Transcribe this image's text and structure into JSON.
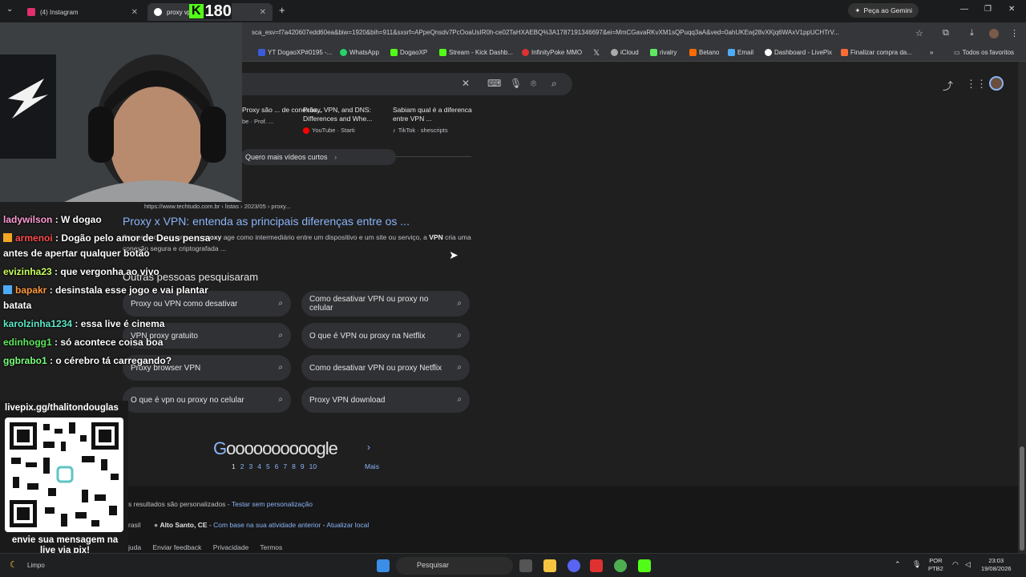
{
  "tabs": [
    {
      "label": "(4) Instagram"
    },
    {
      "label": "proxy vpn - Pesquisa Google"
    }
  ],
  "stream_counter": "180",
  "gemini_button": "Peça ao Gemini",
  "address_bar": {
    "url": "sca_esv=f7a420607edd60ea&biw=1920&bih=911&sxsrf=APpeQnsdv7PcOoaUsIR0h-ce02TaHXAEBQ%3A1787191346697&ei=MmCGavaRKvXM1sQPuqq3aA&ved=0ahUKEwj28vXKjq6WAxV1ppUCHTrV..."
  },
  "bookmarks": [
    {
      "label": "YT DogaoXP#0195 -..."
    },
    {
      "label": "WhatsApp"
    },
    {
      "label": "DogaoXP"
    },
    {
      "label": "Stream - Kick Dashb..."
    },
    {
      "label": "InfinityPoke MMO"
    },
    {
      "label": "iCloud"
    },
    {
      "label": "rivalry"
    },
    {
      "label": "Betano"
    },
    {
      "label": "Email"
    },
    {
      "label": "Dashboard - LivePix"
    },
    {
      "label": "Finalizar compra da..."
    },
    {
      "label": "Todos os favoritos"
    }
  ],
  "shorts": [
    {
      "title": "Proxy são ... de conexão...",
      "source": "be · Prof. ..."
    },
    {
      "title": "Proxy, VPN, and DNS: Differences and Whe...",
      "source": "YouTube · Starti"
    },
    {
      "title": "Sabiam qual é a diferenca entre VPN ...",
      "source": "TikTok · shescripts"
    }
  ],
  "more_shorts": "Quero mais vídeos curtos",
  "result": {
    "url": "https://www.techtudo.com.br › listas › 2023/05 › proxy...",
    "title": "Proxy x VPN: entenda as principais diferenças entre os ...",
    "snippet_a": "Em resumo, enquanto um ",
    "snippet_b": "proxy",
    "snippet_c": " age como intermediário entre um dispositivo e um site ou serviço, a ",
    "snippet_d": "VPN",
    "snippet_e": " cria uma conexão segura e criptografada ..."
  },
  "people_also_search": {
    "title": "Outras pessoas pesquisaram",
    "items": [
      "Proxy ou VPN como desativar",
      "Como desativar VPN ou proxy no celular",
      "VPN proxy gratuito",
      "O que é VPN ou proxy na Netflix",
      "Proxy browser VPN",
      "Como desativar VPN ou proxy Netflix",
      "O que é vpn ou proxy no celular",
      "Proxy VPN download"
    ]
  },
  "pagination": {
    "logo_g": "G",
    "logo_rest": "oooooooooogle",
    "pages": [
      "1",
      "2",
      "3",
      "4",
      "5",
      "6",
      "7",
      "8",
      "9",
      "10"
    ],
    "more": "Mais"
  },
  "footer": {
    "personalized": "s resultados são personalizados - ",
    "test_link": "Testar sem personalização",
    "country": "rasil",
    "location": "Alto Santo, CE",
    "location_basis": "Com base na sua atividade anterior",
    "update_location": "Atualizar local",
    "links": [
      "juda",
      "Enviar feedback",
      "Privacidade",
      "Termos"
    ]
  },
  "chat": [
    {
      "user": "ladywilson",
      "text": " : W dogao",
      "color": "#ff9ad5"
    },
    {
      "user": "armenoi",
      "text": " : Dogão pelo amor de Deus pensa",
      "color": "#ff4d4d",
      "line2": "antes de apertar qualquer botão"
    },
    {
      "user": "evizinha23",
      "text": " : que vergonha ao vivo",
      "color": "#c9ff5e"
    },
    {
      "user": "bapakr",
      "text": " : desinstala esse jogo e vai plantar",
      "color": "#ff9a3c",
      "line2": "batata"
    },
    {
      "user": "karolzinha1234",
      "text": " : essa live é cinema",
      "color": "#5ee8c9"
    },
    {
      "user": "edinhogg1",
      "text": " : só acontece coisa boa",
      "color": "#5ee85e"
    },
    {
      "user": "ggbrabo1",
      "text": " : o cérebro tá carregando?",
      "color": "#7cff7c"
    }
  ],
  "livepix": {
    "title": "livepix.gg/thalitondouglas",
    "message": "envie sua mensagem na live via pix!"
  },
  "taskbar": {
    "weather": "Limpo",
    "search_placeholder": "Pesquisar",
    "lang": "POR\nPTB2",
    "time": "23:03",
    "date": "19/08/2026"
  },
  "colors": {
    "link": "#8ab4f8",
    "bg": "#1f1f1f",
    "kick_green": "#53fc18"
  }
}
